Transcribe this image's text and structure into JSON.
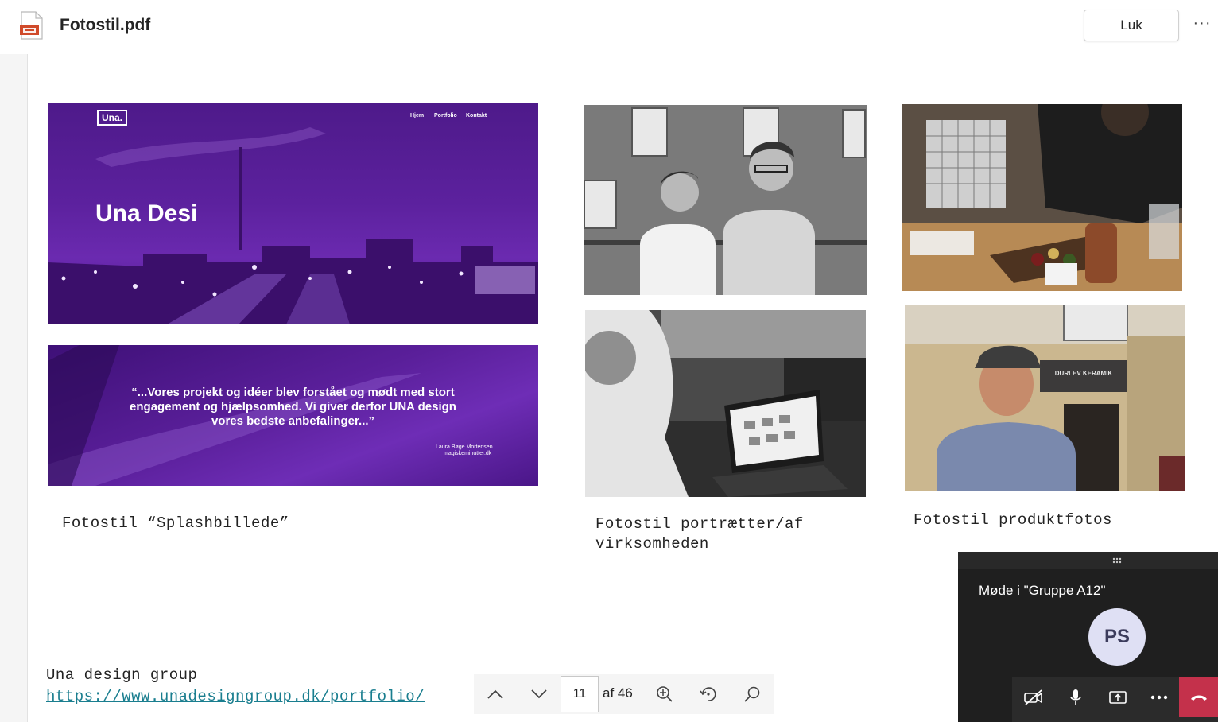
{
  "header": {
    "file_title": "Fotostil.pdf",
    "close_label": "Luk",
    "more_label": "···"
  },
  "pdf": {
    "splash_site": {
      "logo": "Una.",
      "nav": [
        "Hjem",
        "Portfolio",
        "Kontakt"
      ],
      "headline": "Una Desi"
    },
    "quote": {
      "text_line1": "“...Vores projekt og idéer blev forstået og mødt med stort",
      "text_line2": "engagement og hjælpsomhed. Vi giver derfor UNA design",
      "text_line3": "vores bedste anbefalinger...”",
      "author": "Laura Bøge Mortensen",
      "site": "magiskeminutter.dk"
    },
    "shop_sign": "DURLEV KERAMIK",
    "captions": {
      "splash": "Fotostil “Splashbillede”",
      "portraits_line1": "Fotostil portrætter/af",
      "portraits_line2": "virksomheden",
      "products": "Fotostil produktfotos"
    },
    "footer": {
      "company": "Una design group",
      "url": "https://www.unadesigngroup.dk/portfolio/"
    }
  },
  "toolbar": {
    "current_page": "11",
    "of_pages": "af 46"
  },
  "meeting": {
    "title": "Møde i \"Gruppe A12\"",
    "avatar_initials": "PS"
  },
  "colors": {
    "purple": "#5a1f9a",
    "hangup_red": "#c4314b",
    "link": "#1a7e8f"
  }
}
